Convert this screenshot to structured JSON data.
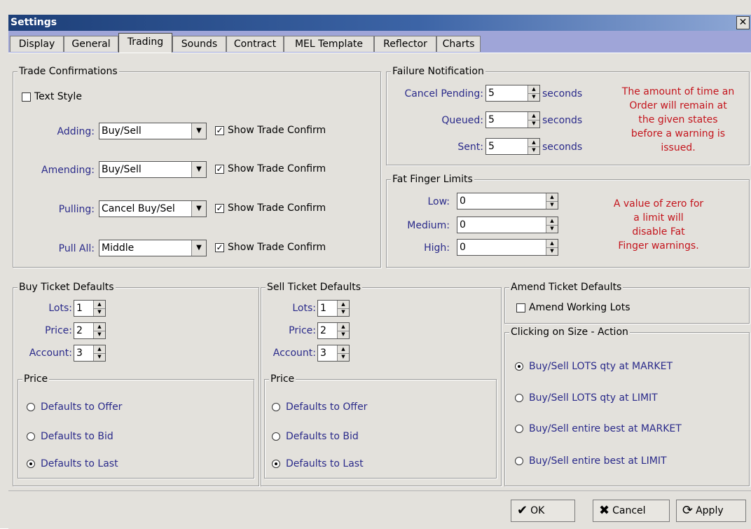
{
  "window": {
    "title": "Settings",
    "close_glyph": "✕"
  },
  "tabs": [
    {
      "label": "Display"
    },
    {
      "label": "General"
    },
    {
      "label": "Trading",
      "active": true
    },
    {
      "label": "Sounds"
    },
    {
      "label": "Contract"
    },
    {
      "label": "MEL Template"
    },
    {
      "label": "Reflector"
    },
    {
      "label": "Charts"
    }
  ],
  "trade_confirmations": {
    "title": "Trade Confirmations",
    "text_style_label": "Text Style",
    "text_style_checked": false,
    "rows": [
      {
        "label": "Adding:",
        "value": "Buy/Sell",
        "confirm_label": "Show Trade Confirm",
        "checked": true
      },
      {
        "label": "Amending:",
        "value": "Buy/Sell",
        "confirm_label": "Show Trade Confirm",
        "checked": true
      },
      {
        "label": "Pulling:",
        "value": "Cancel Buy/Sel",
        "confirm_label": "Show Trade Confirm",
        "checked": true
      },
      {
        "label": "Pull All:",
        "value": "Middle",
        "confirm_label": "Show Trade Confirm",
        "checked": true
      }
    ]
  },
  "failure_notification": {
    "title": "Failure Notification",
    "unit": "seconds",
    "rows": [
      {
        "label": "Cancel Pending:",
        "value": "5"
      },
      {
        "label": "Queued:",
        "value": "5"
      },
      {
        "label": "Sent:",
        "value": "5"
      }
    ],
    "note_lines": [
      "The amount of time an",
      "Order will remain at",
      "the given states",
      "before a warning is",
      "issued."
    ]
  },
  "fat_finger": {
    "title": "Fat Finger Limits",
    "rows": [
      {
        "label": "Low:",
        "value": "0"
      },
      {
        "label": "Medium:",
        "value": "0"
      },
      {
        "label": "High:",
        "value": "0"
      }
    ],
    "note_lines": [
      "A value of zero for",
      "a limit will",
      "disable Fat",
      "Finger warnings."
    ]
  },
  "buy_ticket": {
    "title": "Buy Ticket Defaults",
    "fields": [
      {
        "label": "Lots:",
        "value": "1"
      },
      {
        "label": "Price:",
        "value": "2"
      },
      {
        "label": "Account:",
        "value": "3"
      }
    ],
    "price_title": "Price",
    "price_options": [
      {
        "label": "Defaults to Offer",
        "selected": false
      },
      {
        "label": "Defaults to Bid",
        "selected": false
      },
      {
        "label": "Defaults to Last",
        "selected": true
      }
    ]
  },
  "sell_ticket": {
    "title": "Sell Ticket Defaults",
    "fields": [
      {
        "label": "Lots:",
        "value": "1"
      },
      {
        "label": "Price:",
        "value": "2"
      },
      {
        "label": "Account:",
        "value": "3"
      }
    ],
    "price_title": "Price",
    "price_options": [
      {
        "label": "Defaults to Offer",
        "selected": false
      },
      {
        "label": "Defaults to Bid",
        "selected": false
      },
      {
        "label": "Defaults to Last",
        "selected": true
      }
    ]
  },
  "amend_ticket": {
    "title": "Amend Ticket Defaults",
    "checkbox_label": "Amend Working Lots",
    "checked": false
  },
  "clicking_size": {
    "title": "Clicking on Size - Action",
    "options": [
      {
        "label": "Buy/Sell LOTS qty at MARKET",
        "selected": true
      },
      {
        "label": "Buy/Sell LOTS qty at LIMIT",
        "selected": false
      },
      {
        "label": "Buy/Sell entire best at MARKET",
        "selected": false
      },
      {
        "label": "Buy/Sell entire best at LIMIT",
        "selected": false
      }
    ]
  },
  "buttons": {
    "ok": "OK",
    "ok_icon": "✔",
    "cancel": "Cancel",
    "cancel_icon": "✖",
    "apply": "Apply",
    "apply_icon": "⟳"
  }
}
